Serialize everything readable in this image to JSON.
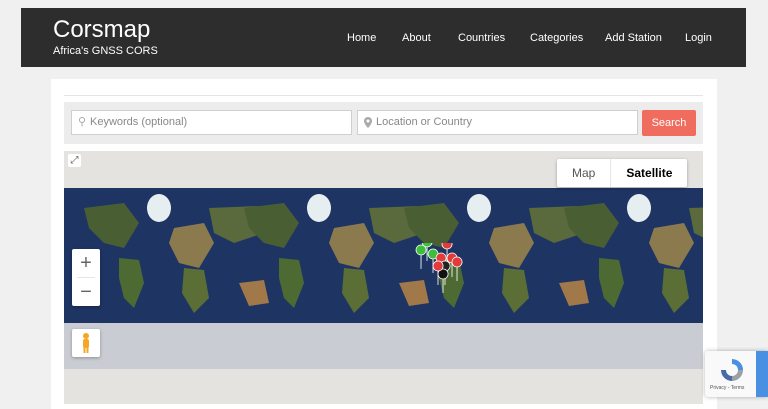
{
  "header": {
    "title": "Corsmap",
    "subtitle": "Africa's GNSS CORS",
    "nav": [
      "Home",
      "About",
      "Countries",
      "Categories",
      "Add Station",
      "Login"
    ]
  },
  "search": {
    "keywords_placeholder": "Keywords (optional)",
    "location_placeholder": "Location or Country",
    "button_label": "Search"
  },
  "map": {
    "types": [
      "Map",
      "Satellite"
    ],
    "active_type": "Satellite",
    "zoom_in": "+",
    "zoom_out": "−"
  },
  "recaptcha": {
    "links": "Privacy - Terms"
  },
  "colors": {
    "header_bg": "#2d2d2d",
    "search_button": "#f06c5f",
    "marker_green": "#3cc03c",
    "marker_red": "#e23b3b"
  }
}
